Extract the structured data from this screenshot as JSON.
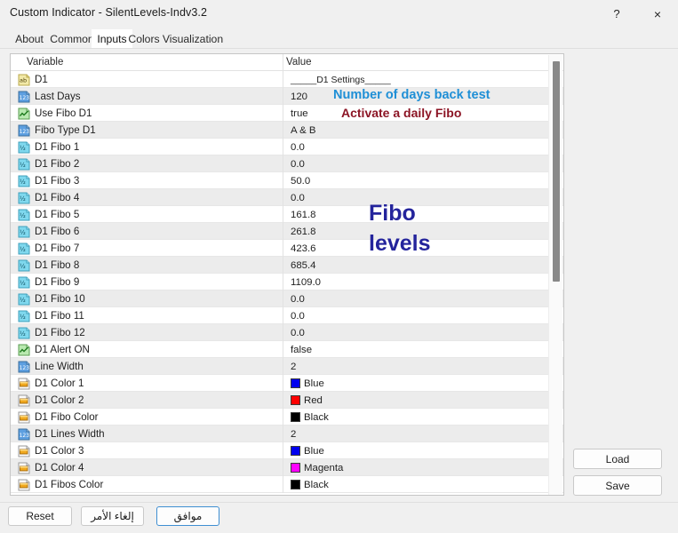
{
  "window": {
    "title": "Custom Indicator - SilentLevels-Indv3.2",
    "help_label": "?",
    "close_label": "×"
  },
  "tabs": [
    {
      "label": "About",
      "active": false
    },
    {
      "label": "Common",
      "active": false
    },
    {
      "label": "Inputs",
      "active": true
    },
    {
      "label": "Colors",
      "active": false
    },
    {
      "label": "Visualization",
      "active": false
    }
  ],
  "grid": {
    "columns": [
      "Variable",
      "Value"
    ],
    "rows": [
      {
        "icon": "string-type-icon",
        "variable": "D1",
        "value": "_____D1 Settings_____",
        "value_kind": "text",
        "stripe": "plain"
      },
      {
        "icon": "integer-type-icon",
        "variable": "Last Days",
        "value": "120",
        "value_kind": "text",
        "stripe": "alt"
      },
      {
        "icon": "bool-type-icon",
        "variable": "Use Fibo D1",
        "value": "true",
        "value_kind": "text",
        "stripe": "plain"
      },
      {
        "icon": "integer-type-icon",
        "variable": "Fibo Type D1",
        "value": "A & B",
        "value_kind": "text",
        "stripe": "alt"
      },
      {
        "icon": "double-type-icon",
        "variable": "D1 Fibo 1",
        "value": "0.0",
        "value_kind": "text",
        "stripe": "plain"
      },
      {
        "icon": "double-type-icon",
        "variable": "D1 Fibo 2",
        "value": "0.0",
        "value_kind": "text",
        "stripe": "alt"
      },
      {
        "icon": "double-type-icon",
        "variable": "D1 Fibo 3",
        "value": "50.0",
        "value_kind": "text",
        "stripe": "plain"
      },
      {
        "icon": "double-type-icon",
        "variable": "D1 Fibo 4",
        "value": "0.0",
        "value_kind": "text",
        "stripe": "alt"
      },
      {
        "icon": "double-type-icon",
        "variable": "D1 Fibo 5",
        "value": "161.8",
        "value_kind": "text",
        "stripe": "plain"
      },
      {
        "icon": "double-type-icon",
        "variable": "D1 Fibo 6",
        "value": "261.8",
        "value_kind": "text",
        "stripe": "alt"
      },
      {
        "icon": "double-type-icon",
        "variable": "D1 Fibo 7",
        "value": "423.6",
        "value_kind": "text",
        "stripe": "plain"
      },
      {
        "icon": "double-type-icon",
        "variable": "D1 Fibo 8",
        "value": "685.4",
        "value_kind": "text",
        "stripe": "alt"
      },
      {
        "icon": "double-type-icon",
        "variable": "D1 Fibo 9",
        "value": "1109.0",
        "value_kind": "text",
        "stripe": "plain"
      },
      {
        "icon": "double-type-icon",
        "variable": "D1 Fibo 10",
        "value": "0.0",
        "value_kind": "text",
        "stripe": "alt"
      },
      {
        "icon": "double-type-icon",
        "variable": "D1 Fibo 11",
        "value": "0.0",
        "value_kind": "text",
        "stripe": "plain"
      },
      {
        "icon": "double-type-icon",
        "variable": "D1 Fibo 12",
        "value": "0.0",
        "value_kind": "text",
        "stripe": "alt"
      },
      {
        "icon": "bool-type-icon",
        "variable": "D1 Alert ON",
        "value": "false",
        "value_kind": "text",
        "stripe": "plain"
      },
      {
        "icon": "integer-type-icon",
        "variable": "Line Width",
        "value": "2",
        "value_kind": "text",
        "stripe": "alt"
      },
      {
        "icon": "color-type-icon",
        "variable": "D1 Color 1",
        "value": "Blue",
        "value_kind": "color",
        "swatch": "#0000ee",
        "stripe": "plain"
      },
      {
        "icon": "color-type-icon",
        "variable": "D1 Color 2",
        "value": "Red",
        "value_kind": "color",
        "swatch": "#ff0000",
        "stripe": "alt"
      },
      {
        "icon": "color-type-icon",
        "variable": "D1 Fibo Color",
        "value": "Black",
        "value_kind": "color",
        "swatch": "#000000",
        "stripe": "plain"
      },
      {
        "icon": "integer-type-icon",
        "variable": "D1 Lines Width",
        "value": "2",
        "value_kind": "text",
        "stripe": "alt"
      },
      {
        "icon": "color-type-icon",
        "variable": "D1 Color 3",
        "value": "Blue",
        "value_kind": "color",
        "swatch": "#0000ee",
        "stripe": "plain"
      },
      {
        "icon": "color-type-icon",
        "variable": "D1 Color 4",
        "value": "Magenta",
        "value_kind": "color",
        "swatch": "#ff00ff",
        "stripe": "alt"
      },
      {
        "icon": "color-type-icon",
        "variable": "D1 Fibos Color",
        "value": "Black",
        "value_kind": "color",
        "swatch": "#000000",
        "stripe": "plain"
      }
    ]
  },
  "annotations": [
    {
      "id": "annot-days",
      "text": "Number of days back test",
      "color": "#1f8fd6"
    },
    {
      "id": "annot-fibo",
      "text": "Activate a daily Fibo",
      "color": "#8c1525"
    },
    {
      "id": "annot-levels-1",
      "text": "Fibo",
      "color": "#24249c"
    },
    {
      "id": "annot-levels-2",
      "text": "levels",
      "color": "#24249c"
    }
  ],
  "side_buttons": {
    "load_label": "Load",
    "save_label": "Save"
  },
  "footer_buttons": {
    "reset_label": "Reset",
    "cancel_label": "إلغاء الأمر",
    "ok_label": "موافق"
  }
}
